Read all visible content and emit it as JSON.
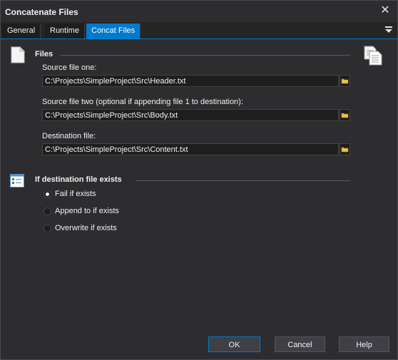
{
  "window": {
    "title": "Concatenate Files"
  },
  "tabs": [
    {
      "label": "General"
    },
    {
      "label": "Runtime"
    },
    {
      "label": "Concat Files"
    }
  ],
  "files_section": {
    "title": "Files",
    "source_one_label": "Source file one:",
    "source_one_value": "C:\\Projects\\SimpleProject\\Src\\Header.txt",
    "source_two_label": "Source file two (optional if appending file 1 to destination):",
    "source_two_value": "C:\\Projects\\SimpleProject\\Src\\Body.txt",
    "destination_label": "Destination file:",
    "destination_value": "C:\\Projects\\SimpleProject\\Src\\Content.txt"
  },
  "exists_section": {
    "title": "If destination file exists",
    "options": [
      {
        "label": "Fail if exists",
        "selected": true
      },
      {
        "label": "Append to if exists",
        "selected": false
      },
      {
        "label": "Overwrite if exists",
        "selected": false
      }
    ]
  },
  "buttons": {
    "ok": "OK",
    "cancel": "Cancel",
    "help": "Help"
  },
  "colors": {
    "accent": "#007acc",
    "background": "#2d2d30",
    "input_bg": "#1e1e1e"
  }
}
